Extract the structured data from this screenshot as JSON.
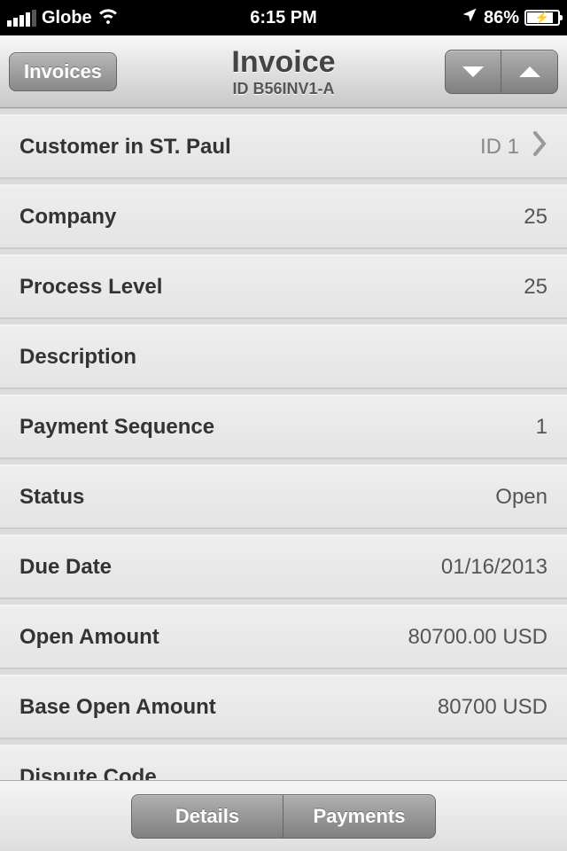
{
  "status": {
    "carrier": "Globe",
    "time": "6:15 PM",
    "battery": "86%"
  },
  "nav": {
    "back": "Invoices",
    "title": "Invoice",
    "subtitle": "ID B56INV1-A"
  },
  "rows": [
    {
      "label": "Customer in ST. Paul",
      "value": "ID 1",
      "chevron": true
    },
    {
      "label": "Company",
      "value": "25"
    },
    {
      "label": "Process Level",
      "value": "25"
    },
    {
      "label": "Description",
      "value": ""
    },
    {
      "label": "Payment Sequence",
      "value": "1"
    },
    {
      "label": "Status",
      "value": "Open"
    },
    {
      "label": "Due Date",
      "value": "01/16/2013"
    },
    {
      "label": "Open Amount",
      "value": "80700.00 USD"
    },
    {
      "label": "Base Open Amount",
      "value": "80700 USD"
    },
    {
      "label": "Dispute Code",
      "value": ""
    }
  ],
  "toolbar": {
    "details": "Details",
    "payments": "Payments"
  }
}
